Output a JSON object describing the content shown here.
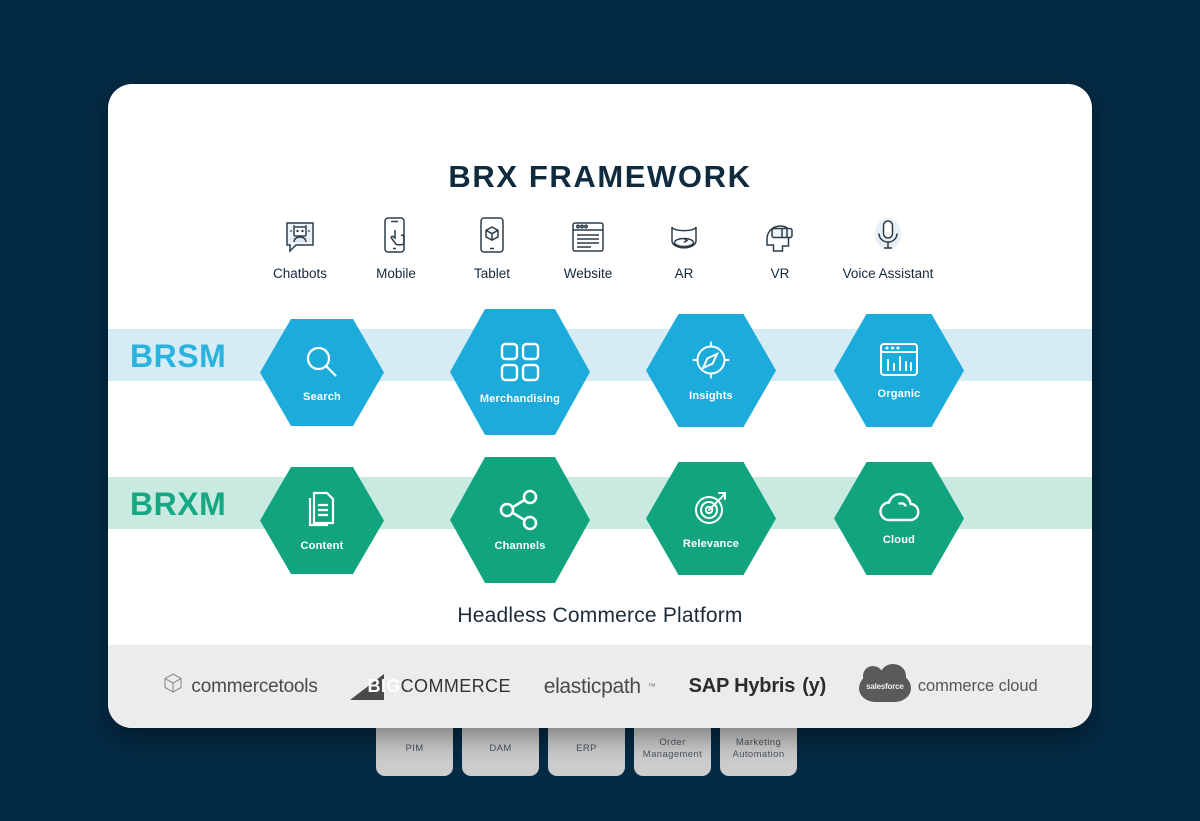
{
  "page": {
    "background_color": "#042b44",
    "card_background": "#ffffff"
  },
  "header": {
    "title": "BRX FRAMEWORK"
  },
  "channels": [
    {
      "label": "Chatbots",
      "icon": "chatbot-icon"
    },
    {
      "label": "Mobile",
      "icon": "mobile-phone-tap-icon"
    },
    {
      "label": "Tablet",
      "icon": "tablet-cube-icon"
    },
    {
      "label": "Website",
      "icon": "browser-window-icon"
    },
    {
      "label": "AR",
      "icon": "augmented-reality-icon"
    },
    {
      "label": "VR",
      "icon": "vr-headset-icon"
    },
    {
      "label": "Voice Assistant",
      "icon": "microphone-icon"
    }
  ],
  "rows": [
    {
      "label": "BRSM",
      "color": "#2bb3df",
      "hex_color": "#1cabdb",
      "band_color": "#d5ecf5",
      "items": [
        {
          "label": "Search",
          "icon": "magnifier-icon"
        },
        {
          "label": "Merchandising",
          "icon": "grid-squares-icon"
        },
        {
          "label": "Insights",
          "icon": "compass-icon"
        },
        {
          "label": "Organic",
          "icon": "bar-chart-window-icon"
        }
      ]
    },
    {
      "label": "BRXM",
      "color": "#16a883",
      "hex_color": "#11a47f",
      "band_color": "#c9eae0",
      "items": [
        {
          "label": "Content",
          "icon": "documents-icon"
        },
        {
          "label": "Channels",
          "icon": "share-nodes-icon"
        },
        {
          "label": "Relevance",
          "icon": "target-arrow-icon"
        },
        {
          "label": "Cloud",
          "icon": "cloud-icon"
        }
      ]
    }
  ],
  "subtitle": "Headless Commerce Platform",
  "partners": [
    {
      "name": "commercetools",
      "icon": "cube-outline-icon"
    },
    {
      "name": "COMMERCE",
      "prefix": "BIG",
      "icon": "triangle-icon"
    },
    {
      "name": "elasticpath",
      "trademark": "™"
    },
    {
      "name": "SAP Hybris",
      "suffix": "(y)"
    },
    {
      "name": "commerce cloud",
      "badge": "salesforce",
      "icon": "salesforce-cloud-icon"
    }
  ],
  "bottom_systems": [
    {
      "label": "PIM"
    },
    {
      "label": "DAM"
    },
    {
      "label": "ERP"
    },
    {
      "label": "Order Management"
    },
    {
      "label": "Marketing Automation"
    }
  ]
}
